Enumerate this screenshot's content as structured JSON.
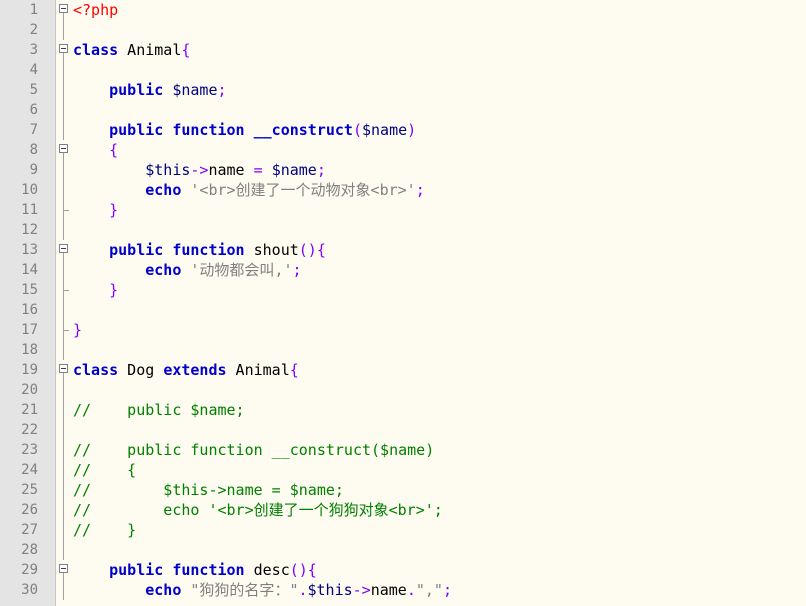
{
  "editor": {
    "language": "php",
    "colors": {
      "background": "#fefcf0",
      "gutter": "#e4e4e4",
      "keyword": "#0000cc",
      "variable": "#000080",
      "string": "#808080",
      "operator": "#8000ff",
      "php_tag": "#ff0000",
      "comment": "#008000"
    },
    "lines": [
      {
        "n": "1",
        "fold": "open-start",
        "tokens": [
          {
            "t": "php",
            "v": "<?php"
          }
        ]
      },
      {
        "n": "2",
        "fold": "line",
        "tokens": []
      },
      {
        "n": "3",
        "fold": "open",
        "tokens": [
          {
            "t": "kw",
            "v": "class"
          },
          {
            "t": "plain",
            "v": " Animal"
          },
          {
            "t": "op",
            "v": "{"
          }
        ]
      },
      {
        "n": "4",
        "fold": "line",
        "tokens": []
      },
      {
        "n": "5",
        "fold": "line",
        "tokens": [
          {
            "t": "plain",
            "v": "    "
          },
          {
            "t": "kw",
            "v": "public"
          },
          {
            "t": "plain",
            "v": " "
          },
          {
            "t": "var",
            "v": "$name"
          },
          {
            "t": "op",
            "v": ";"
          }
        ]
      },
      {
        "n": "6",
        "fold": "line",
        "tokens": []
      },
      {
        "n": "7",
        "fold": "line",
        "tokens": [
          {
            "t": "plain",
            "v": "    "
          },
          {
            "t": "kw",
            "v": "public function"
          },
          {
            "t": "plain",
            "v": " "
          },
          {
            "t": "kw",
            "v": "__construct"
          },
          {
            "t": "op",
            "v": "("
          },
          {
            "t": "var",
            "v": "$name"
          },
          {
            "t": "op",
            "v": ")"
          }
        ]
      },
      {
        "n": "8",
        "fold": "open",
        "tokens": [
          {
            "t": "plain",
            "v": "    "
          },
          {
            "t": "op",
            "v": "{"
          }
        ]
      },
      {
        "n": "9",
        "fold": "line",
        "tokens": [
          {
            "t": "plain",
            "v": "        "
          },
          {
            "t": "var",
            "v": "$this"
          },
          {
            "t": "op",
            "v": "->"
          },
          {
            "t": "plain",
            "v": "name "
          },
          {
            "t": "op",
            "v": "="
          },
          {
            "t": "plain",
            "v": " "
          },
          {
            "t": "var",
            "v": "$name"
          },
          {
            "t": "op",
            "v": ";"
          }
        ]
      },
      {
        "n": "10",
        "fold": "line",
        "tokens": [
          {
            "t": "plain",
            "v": "        "
          },
          {
            "t": "kw",
            "v": "echo"
          },
          {
            "t": "plain",
            "v": " "
          },
          {
            "t": "str",
            "v": "'<br>创建了一个动物对象<br>'"
          },
          {
            "t": "op",
            "v": ";"
          }
        ]
      },
      {
        "n": "11",
        "fold": "end",
        "tokens": [
          {
            "t": "plain",
            "v": "    "
          },
          {
            "t": "op",
            "v": "}"
          }
        ]
      },
      {
        "n": "12",
        "fold": "line",
        "tokens": []
      },
      {
        "n": "13",
        "fold": "open",
        "tokens": [
          {
            "t": "plain",
            "v": "    "
          },
          {
            "t": "kw",
            "v": "public function"
          },
          {
            "t": "plain",
            "v": " shout"
          },
          {
            "t": "op",
            "v": "(){"
          }
        ]
      },
      {
        "n": "14",
        "fold": "line",
        "tokens": [
          {
            "t": "plain",
            "v": "        "
          },
          {
            "t": "kw",
            "v": "echo"
          },
          {
            "t": "plain",
            "v": " "
          },
          {
            "t": "str",
            "v": "'动物都会叫,'"
          },
          {
            "t": "op",
            "v": ";"
          }
        ]
      },
      {
        "n": "15",
        "fold": "end",
        "tokens": [
          {
            "t": "plain",
            "v": "    "
          },
          {
            "t": "op",
            "v": "}"
          }
        ]
      },
      {
        "n": "16",
        "fold": "line",
        "tokens": []
      },
      {
        "n": "17",
        "fold": "end",
        "tokens": [
          {
            "t": "op",
            "v": "}"
          }
        ]
      },
      {
        "n": "18",
        "fold": "line",
        "tokens": []
      },
      {
        "n": "19",
        "fold": "open",
        "tokens": [
          {
            "t": "kw",
            "v": "class"
          },
          {
            "t": "plain",
            "v": " Dog "
          },
          {
            "t": "kw",
            "v": "extends"
          },
          {
            "t": "plain",
            "v": " Animal"
          },
          {
            "t": "op",
            "v": "{"
          }
        ]
      },
      {
        "n": "20",
        "fold": "line",
        "tokens": []
      },
      {
        "n": "21",
        "fold": "line",
        "tokens": [
          {
            "t": "cm",
            "v": "//    public $name;"
          }
        ]
      },
      {
        "n": "22",
        "fold": "line",
        "tokens": []
      },
      {
        "n": "23",
        "fold": "line",
        "tokens": [
          {
            "t": "cm",
            "v": "//    public function __construct($name)"
          }
        ]
      },
      {
        "n": "24",
        "fold": "line",
        "tokens": [
          {
            "t": "cm",
            "v": "//    {"
          }
        ]
      },
      {
        "n": "25",
        "fold": "line",
        "tokens": [
          {
            "t": "cm",
            "v": "//        $this->name = $name;"
          }
        ]
      },
      {
        "n": "26",
        "fold": "line",
        "tokens": [
          {
            "t": "cm",
            "v": "//        echo '<br>创建了一个狗狗对象<br>';"
          }
        ]
      },
      {
        "n": "27",
        "fold": "line",
        "tokens": [
          {
            "t": "cm",
            "v": "//    }"
          }
        ]
      },
      {
        "n": "28",
        "fold": "line",
        "tokens": []
      },
      {
        "n": "29",
        "fold": "open",
        "tokens": [
          {
            "t": "plain",
            "v": "    "
          },
          {
            "t": "kw",
            "v": "public function"
          },
          {
            "t": "plain",
            "v": " desc"
          },
          {
            "t": "op",
            "v": "(){"
          }
        ]
      },
      {
        "n": "30",
        "fold": "line",
        "tokens": [
          {
            "t": "plain",
            "v": "        "
          },
          {
            "t": "kw",
            "v": "echo"
          },
          {
            "t": "plain",
            "v": " "
          },
          {
            "t": "str",
            "v": "\"狗狗的名字：\""
          },
          {
            "t": "op",
            "v": "."
          },
          {
            "t": "var",
            "v": "$this"
          },
          {
            "t": "op",
            "v": "->"
          },
          {
            "t": "plain",
            "v": "name"
          },
          {
            "t": "op",
            "v": "."
          },
          {
            "t": "str",
            "v": "\",\""
          },
          {
            "t": "op",
            "v": ";"
          }
        ]
      }
    ]
  }
}
